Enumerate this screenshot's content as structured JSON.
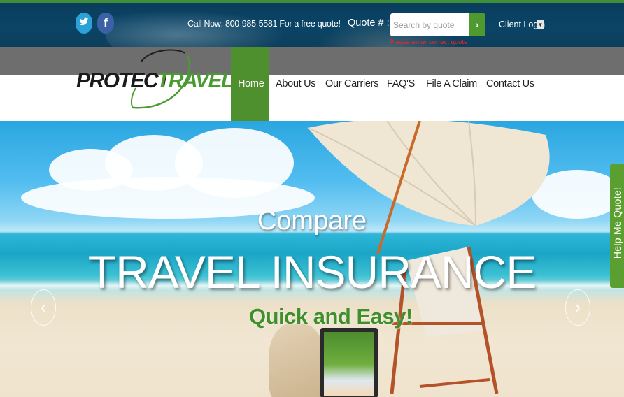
{
  "topbar": {
    "twitter": {
      "icon": "twitter-icon"
    },
    "facebook": {
      "icon": "facebook-icon",
      "glyph": "f"
    },
    "call_now": "Call Now: 800-985-5581 For a free quote!",
    "quote_label": "Quote # :",
    "quote_placeholder": "Search by quote",
    "quote_go": "›",
    "quote_error": "Please enter correct quote number",
    "client_login": "Client Login",
    "client_login_caret": "▼"
  },
  "logo": {
    "part1": "PROTECT",
    "part2": "TRAVEL"
  },
  "nav": {
    "items": [
      "Home",
      "About Us",
      "Our Carriers",
      "FAQ'S",
      "File A Claim",
      "Contact Us"
    ],
    "active": "Home"
  },
  "hero": {
    "line1": "Compare",
    "line2": "TRAVEL INSURANCE",
    "line3": "Quick and Easy!",
    "prev": "‹",
    "next": "›"
  },
  "help_tab": "Help Me Quote!",
  "colors": {
    "topbar": "#0a4466",
    "accent_green": "#4e8f2e",
    "nav_band": "#6e6e6e",
    "error_red": "#ff2020"
  }
}
